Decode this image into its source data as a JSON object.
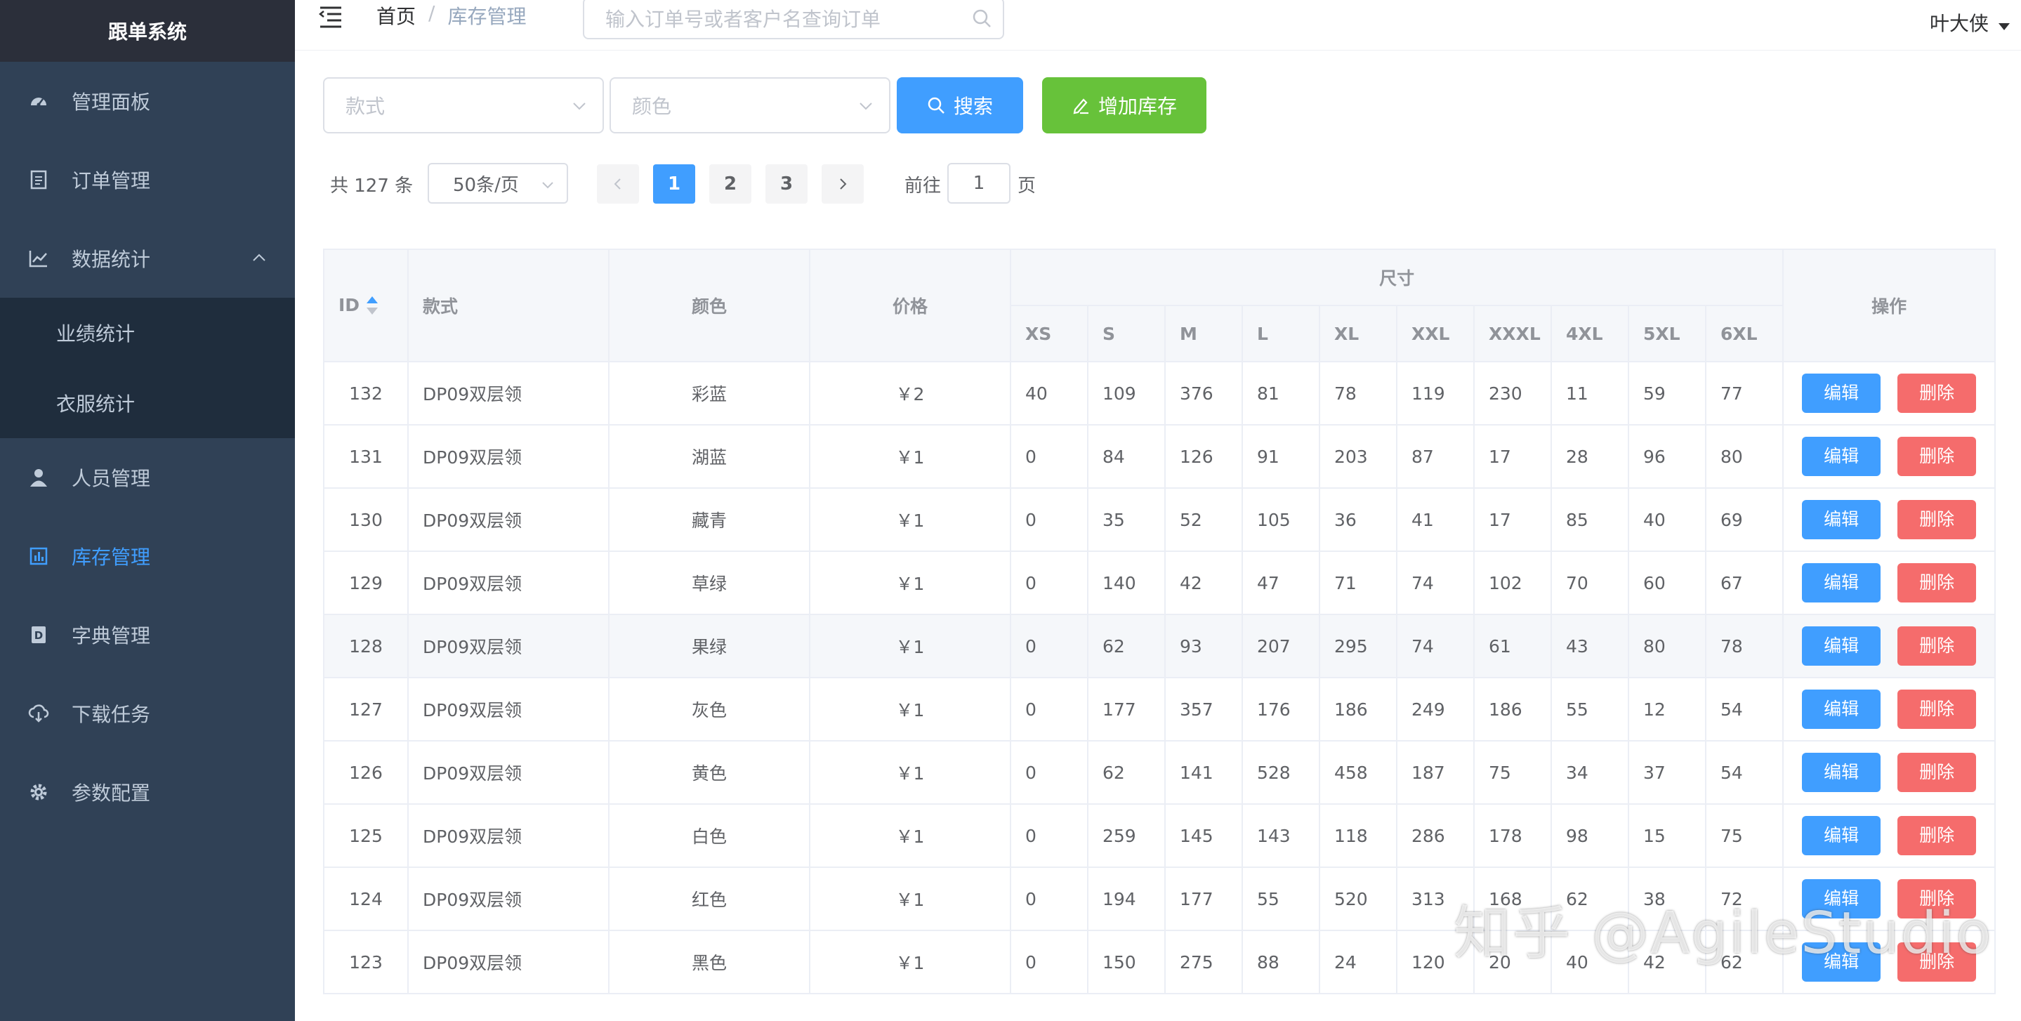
{
  "app_title": "跟单系统",
  "sidebar": {
    "items": [
      {
        "label": "管理面板",
        "icon": "dashboard-icon"
      },
      {
        "label": "订单管理",
        "icon": "document-icon"
      },
      {
        "label": "数据统计",
        "icon": "line-chart-icon",
        "expanded": true,
        "children": [
          {
            "label": "业绩统计"
          },
          {
            "label": "衣服统计"
          }
        ]
      },
      {
        "label": "人员管理",
        "icon": "user-icon"
      },
      {
        "label": "库存管理",
        "icon": "inventory-icon",
        "active": true
      },
      {
        "label": "字典管理",
        "icon": "dictionary-icon"
      },
      {
        "label": "下载任务",
        "icon": "cloud-download-icon"
      },
      {
        "label": "参数配置",
        "icon": "gear-icon"
      }
    ]
  },
  "navbar": {
    "breadcrumb": {
      "home": "首页",
      "separator": "/",
      "current": "库存管理"
    },
    "search_placeholder": "输入订单号或者客户名查询订单",
    "user": "叶大侠"
  },
  "filters": {
    "style_placeholder": "款式",
    "color_placeholder": "颜色",
    "search_button": "搜索",
    "add_button": "增加库存"
  },
  "pagination": {
    "total": "共 127 条",
    "page_size": "50条/页",
    "pages": [
      "1",
      "2",
      "3"
    ],
    "current": "1",
    "goto_label": "前往",
    "goto_value": "1",
    "goto_unit": "页"
  },
  "table": {
    "headers": {
      "id": "ID",
      "style": "款式",
      "color": "颜色",
      "price": "价格",
      "size_group": "尺寸",
      "actions": "操作"
    },
    "sizes": [
      "XS",
      "S",
      "M",
      "L",
      "XL",
      "XXL",
      "XXXL",
      "4XL",
      "5XL",
      "6XL"
    ],
    "edit_label": "编辑",
    "delete_label": "删除",
    "rows": [
      {
        "id": "132",
        "style": "DP09双层领",
        "color": "彩蓝",
        "price": "￥2",
        "sizes": [
          "40",
          "109",
          "376",
          "81",
          "78",
          "119",
          "230",
          "11",
          "59",
          "77"
        ]
      },
      {
        "id": "131",
        "style": "DP09双层领",
        "color": "湖蓝",
        "price": "￥1",
        "sizes": [
          "0",
          "84",
          "126",
          "91",
          "203",
          "87",
          "17",
          "28",
          "96",
          "80"
        ]
      },
      {
        "id": "130",
        "style": "DP09双层领",
        "color": "藏青",
        "price": "￥1",
        "sizes": [
          "0",
          "35",
          "52",
          "105",
          "36",
          "41",
          "17",
          "85",
          "40",
          "69"
        ]
      },
      {
        "id": "129",
        "style": "DP09双层领",
        "color": "草绿",
        "price": "￥1",
        "sizes": [
          "0",
          "140",
          "42",
          "47",
          "71",
          "74",
          "102",
          "70",
          "60",
          "67"
        ]
      },
      {
        "id": "128",
        "style": "DP09双层领",
        "color": "果绿",
        "price": "￥1",
        "sizes": [
          "0",
          "62",
          "93",
          "207",
          "295",
          "74",
          "61",
          "43",
          "80",
          "78"
        ]
      },
      {
        "id": "127",
        "style": "DP09双层领",
        "color": "灰色",
        "price": "￥1",
        "sizes": [
          "0",
          "177",
          "357",
          "176",
          "186",
          "249",
          "186",
          "55",
          "12",
          "54"
        ]
      },
      {
        "id": "126",
        "style": "DP09双层领",
        "color": "黄色",
        "price": "￥1",
        "sizes": [
          "0",
          "62",
          "141",
          "528",
          "458",
          "187",
          "75",
          "34",
          "37",
          "54"
        ]
      },
      {
        "id": "125",
        "style": "DP09双层领",
        "color": "白色",
        "price": "￥1",
        "sizes": [
          "0",
          "259",
          "145",
          "143",
          "118",
          "286",
          "178",
          "98",
          "15",
          "75"
        ]
      },
      {
        "id": "124",
        "style": "DP09双层领",
        "color": "红色",
        "price": "￥1",
        "sizes": [
          "0",
          "194",
          "177",
          "55",
          "520",
          "313",
          "168",
          "62",
          "38",
          "72"
        ]
      },
      {
        "id": "123",
        "style": "DP09双层领",
        "color": "黑色",
        "price": "￥1",
        "sizes": [
          "0",
          "150",
          "275",
          "88",
          "24",
          "120",
          "20",
          "40",
          "42",
          "62"
        ]
      }
    ]
  },
  "watermark": "知乎 @AgileStudio",
  "colors": {
    "sidebar_bg": "#304156",
    "primary": "#409eff",
    "success": "#67c23a",
    "danger": "#f56c6c"
  }
}
